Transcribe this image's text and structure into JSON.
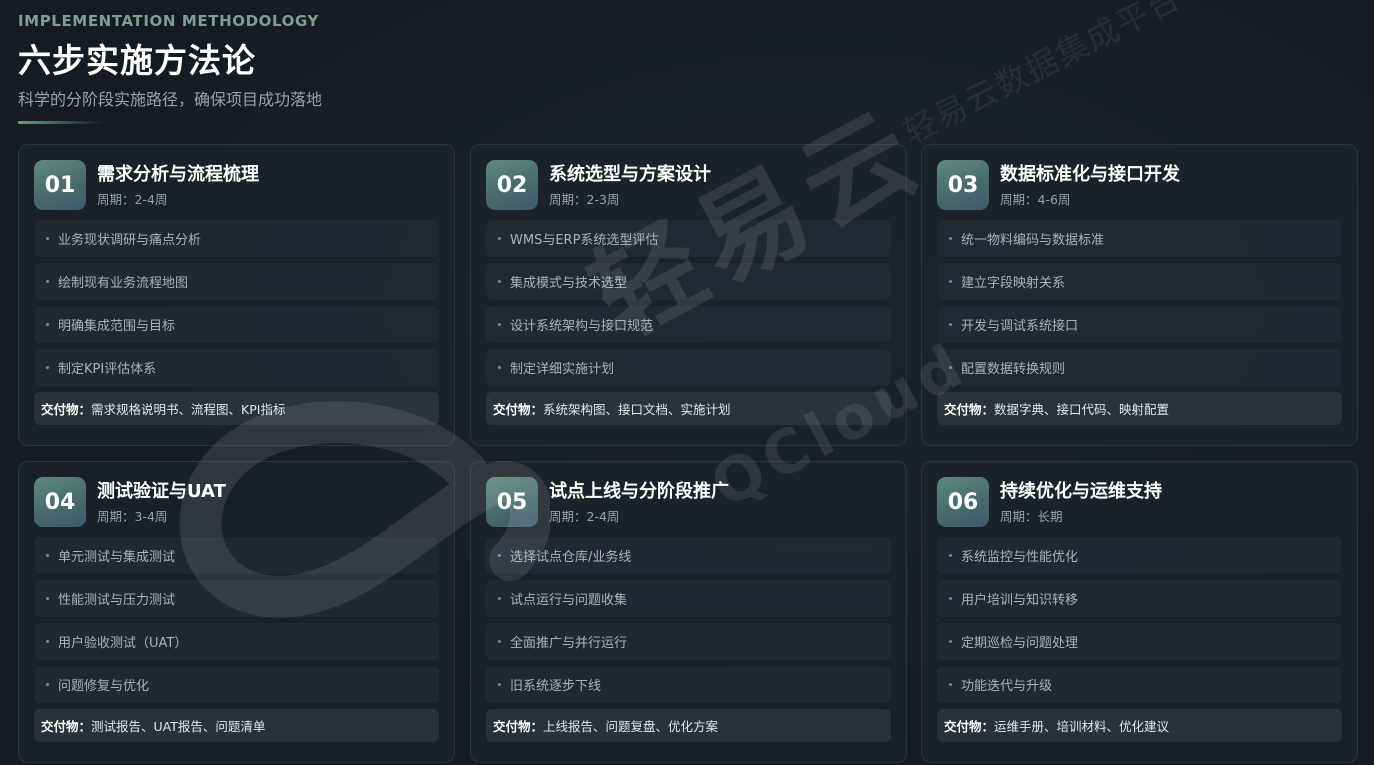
{
  "header": {
    "eyebrow": "IMPLEMENTATION METHODOLOGY",
    "title": "六步实施方法论",
    "subtitle": "科学的分阶段实施路径，确保项目成功落地"
  },
  "deliver_label": "交付物：",
  "steps": [
    {
      "num": "01",
      "title": "需求分析与流程梳理",
      "period": "周期：2-4周",
      "items": [
        "业务现状调研与痛点分析",
        "绘制现有业务流程地图",
        "明确集成范围与目标",
        "制定KPI评估体系"
      ],
      "deliverables": "需求规格说明书、流程图、KPI指标"
    },
    {
      "num": "02",
      "title": "系统选型与方案设计",
      "period": "周期：2-3周",
      "items": [
        "WMS与ERP系统选型评估",
        "集成模式与技术选型",
        "设计系统架构与接口规范",
        "制定详细实施计划"
      ],
      "deliverables": "系统架构图、接口文档、实施计划"
    },
    {
      "num": "03",
      "title": "数据标准化与接口开发",
      "period": "周期：4-6周",
      "items": [
        "统一物料编码与数据标准",
        "建立字段映射关系",
        "开发与调试系统接口",
        "配置数据转换规则"
      ],
      "deliverables": "数据字典、接口代码、映射配置"
    },
    {
      "num": "04",
      "title": "测试验证与UAT",
      "period": "周期：3-4周",
      "items": [
        "单元测试与集成测试",
        "性能测试与压力测试",
        "用户验收测试（UAT）",
        "问题修复与优化"
      ],
      "deliverables": "测试报告、UAT报告、问题清单"
    },
    {
      "num": "05",
      "title": "试点上线与分阶段推广",
      "period": "周期：2-4周",
      "items": [
        "选择试点仓库/业务线",
        "试点运行与问题收集",
        "全面推广与并行运行",
        "旧系统逐步下线"
      ],
      "deliverables": "上线报告、问题复盘、优化方案"
    },
    {
      "num": "06",
      "title": "持续优化与运维支持",
      "period": "周期：长期",
      "items": [
        "系统监控与性能优化",
        "用户培训与知识转移",
        "定期巡检与问题处理",
        "功能迭代与升级"
      ],
      "deliverables": "运维手册、培训材料、优化建议"
    }
  ],
  "watermark": {
    "corner_text": "轻易云数据集成平台",
    "big_text": "轻易云",
    "brand_text": "QCloud"
  }
}
